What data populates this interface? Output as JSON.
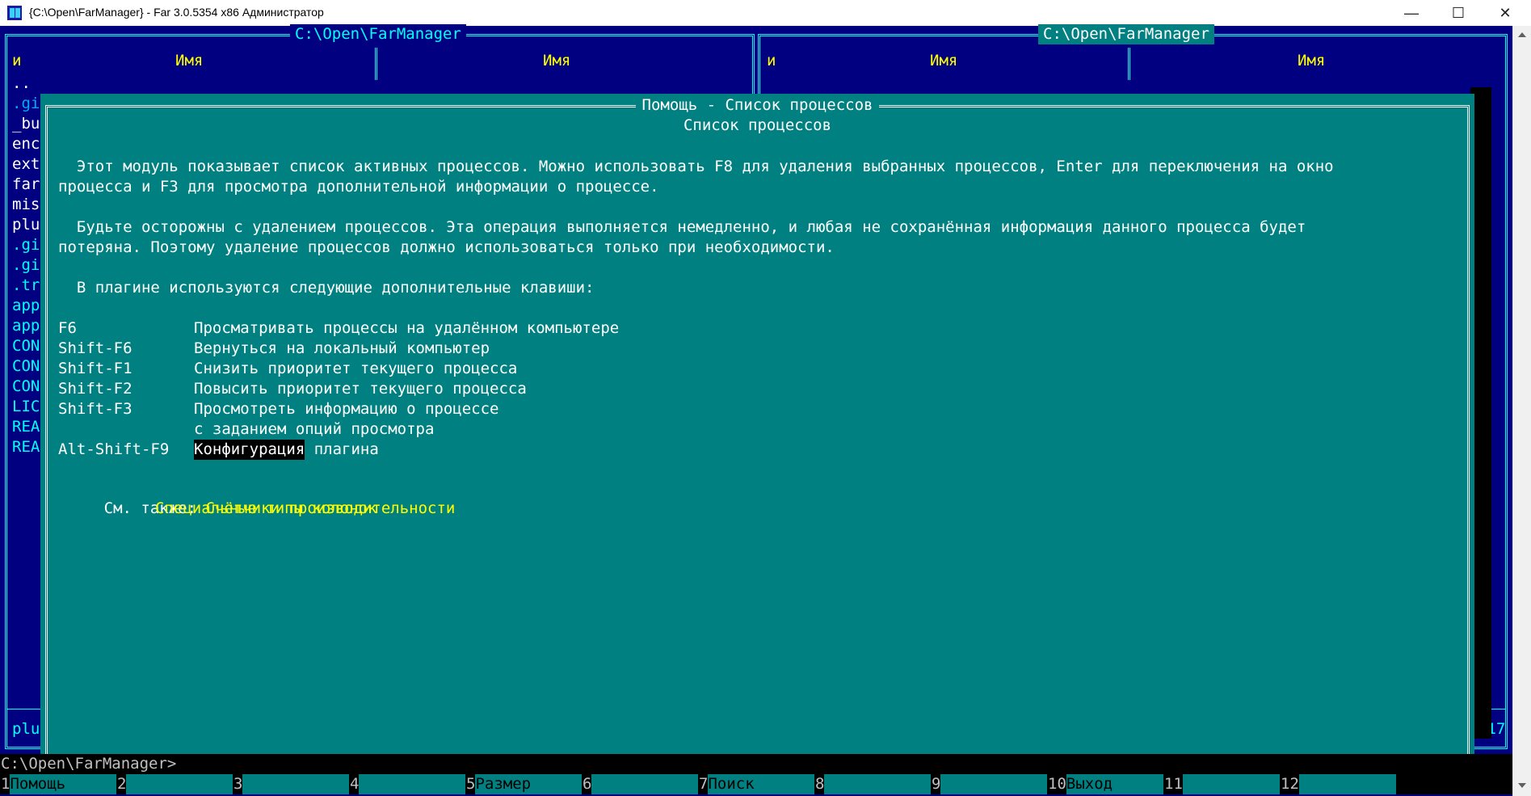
{
  "window": {
    "title": "{C:\\Open\\FarManager} - Far 3.0.5354 x86 Администратор",
    "minimize_glyph": "—",
    "maximize_glyph": "☐",
    "close_glyph": "✕"
  },
  "panels": {
    "left": {
      "path": "C:\\Open\\FarManager",
      "col1_header": "и",
      "col2_header": "Имя",
      "col3_header": "Имя",
      "files": [
        ".. ",
        ".gi",
        "_bu",
        "enc",
        "ext",
        "far",
        "mis",
        "plu",
        ".gi",
        ".gi",
        ".tr",
        "app",
        "app",
        "CON",
        "CON",
        "CON",
        "LIC",
        "REA",
        "REA"
      ],
      "footer": "plu"
    },
    "right": {
      "path": "C:\\Open\\FarManager",
      "col1_header": "и",
      "col2_header": "Имя",
      "col3_header": "Имя",
      "footer": ":17"
    }
  },
  "help": {
    "title": "Помощь - Список процессов",
    "heading": "Список процессов",
    "para1_line1": "  Этот модуль показывает список активных процессов. Можно использовать F8 для удаления выбранных процессов, Enter для переключения на окно",
    "para1_line2": "процесса и F3 для просмотра дополнительной информации о процессе.",
    "para2_line1": "  Будьте осторожны с удалением процессов. Эта операция выполняется немедленно, и любая не сохранённая информация данного процесса будет",
    "para2_line2": "потеряна. Поэтому удаление процессов должно использоваться только при необходимости.",
    "para3": "  В плагине используются следующие дополнительные клавиши:",
    "keys": [
      {
        "key": "F6",
        "desc": "Просматривать процессы на удалённом компьютере"
      },
      {
        "key": "Shift-F6",
        "desc": "Вернуться на локальный компьютер"
      },
      {
        "key": "Shift-F1",
        "desc": "Снизить приоритет текущего процесса"
      },
      {
        "key": "Shift-F2",
        "desc": "Повысить приоритет текущего процесса"
      },
      {
        "key": "Shift-F3",
        "desc": "Просмотреть информацию о процессе"
      },
      {
        "key": "",
        "desc": "с заданием опций просмотра"
      }
    ],
    "last_key": "Alt-Shift-F9",
    "last_key_link": "Конфигурация",
    "last_key_rest": " плагина",
    "see_also_label": "См. также: ",
    "see_also_link1": "Счётчики производительности",
    "see_also_link2": "Специальные типы колонок"
  },
  "cmdline": "C:\\Open\\FarManager>",
  "keybar": [
    {
      "num": "1",
      "label": "Помощь"
    },
    {
      "num": "2",
      "label": ""
    },
    {
      "num": "3",
      "label": ""
    },
    {
      "num": "4",
      "label": ""
    },
    {
      "num": "5",
      "label": "Размер"
    },
    {
      "num": "6",
      "label": ""
    },
    {
      "num": "7",
      "label": "Поиск"
    },
    {
      "num": "8",
      "label": ""
    },
    {
      "num": "9",
      "label": ""
    },
    {
      "num": "10",
      "label": "Выход"
    },
    {
      "num": "11",
      "label": ""
    },
    {
      "num": "12",
      "label": ""
    }
  ],
  "colors": {
    "panel_bg": "#000080",
    "panel_fg": "#00ffff",
    "help_bg": "#008080",
    "header": "#ffff00",
    "link": "#ffff00"
  }
}
